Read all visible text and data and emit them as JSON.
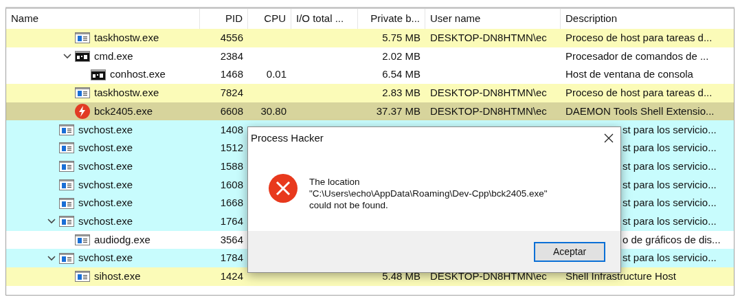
{
  "columns": [
    {
      "label": "Name"
    },
    {
      "label": "PID"
    },
    {
      "label": "CPU"
    },
    {
      "label": "I/O total ..."
    },
    {
      "label": "Private b..."
    },
    {
      "label": "User name"
    },
    {
      "label": "Description"
    }
  ],
  "rows": [
    {
      "children": [
        {
          "name": "taskhostw.exe",
          "kind": "window",
          "pid": "4556",
          "private": "5.75 MB",
          "user": "DESKTOP-DN8HTMN\\ec",
          "description": "Proceso de host para tareas d...",
          "color": "#fbfbb8"
        },
        {
          "name": "cmd.exe",
          "kind": "console",
          "pid": "2384",
          "private": "2.02 MB",
          "description": "Procesador de comandos de ...",
          "color": "#ffffff",
          "expanded": true,
          "children": [
            {
              "name": "conhost.exe",
              "kind": "console",
              "pid": "1468",
              "cpu": "0.01",
              "private": "6.54 MB",
              "description": "Host de ventana de consola",
              "color": "#ffffff"
            }
          ]
        },
        {
          "name": "taskhostw.exe",
          "kind": "window",
          "pid": "7824",
          "private": "2.83 MB",
          "user": "DESKTOP-DN8HTMN\\ec",
          "description": "Proceso de host para tareas d...",
          "color": "#fbfbb8"
        },
        {
          "name": "bck2405.exe",
          "kind": "bolt",
          "pid": "6608",
          "cpu": "30.80",
          "private": "37.37 MB",
          "user": "DESKTOP-DN8HTMN\\ec",
          "description": "DAEMON Tools Shell Extensio...",
          "color": "#d7d49c"
        }
      ]
    },
    {
      "name": "svchost.exe",
      "kind": "window",
      "pid": "1408",
      "description": "st para los servicio...",
      "clipped": true,
      "color": "#c8fcfd"
    },
    {
      "name": "svchost.exe",
      "kind": "window",
      "pid": "1512",
      "description": "st para los servicio...",
      "clipped": true,
      "color": "#c8fcfd"
    },
    {
      "name": "svchost.exe",
      "kind": "window",
      "pid": "1588",
      "description": "st para los servicio...",
      "clipped": true,
      "color": "#c8fcfd"
    },
    {
      "name": "svchost.exe",
      "kind": "window",
      "pid": "1608",
      "description": "st para los servicio...",
      "clipped": true,
      "color": "#c8fcfd"
    },
    {
      "name": "svchost.exe",
      "kind": "window",
      "pid": "1668",
      "description": "st para los servicio...",
      "clipped": true,
      "color": "#c8fcfd"
    },
    {
      "name": "svchost.exe",
      "kind": "window",
      "pid": "1764",
      "description": "st para los servicio...",
      "clipped": true,
      "color": "#c8fcfd",
      "expanded": true,
      "children": [
        {
          "name": "audiodg.exe",
          "kind": "window",
          "pid": "3564",
          "description": "o de gráficos de dis...",
          "clipped": true,
          "color": "#ffffff"
        }
      ]
    },
    {
      "name": "svchost.exe",
      "kind": "window",
      "pid": "1784",
      "description": "st para los servicio...",
      "clipped": true,
      "color": "#c8fcfd",
      "expanded": true,
      "children": [
        {
          "name": "sihost.exe",
          "kind": "window",
          "pid": "1424",
          "private": "5.48 MB",
          "user": "DESKTOP-DN8HTMN\\ec",
          "description": "Shell Infrastructure Host",
          "color": "#fbfbb8"
        }
      ]
    }
  ],
  "dialog": {
    "title": "Process Hacker",
    "message": "The location\n\"C:\\Users\\echo\\AppData\\Roaming\\Dev-Cpp\\bck2405.exe\"\ncould not be found.",
    "button": "Aceptar"
  }
}
